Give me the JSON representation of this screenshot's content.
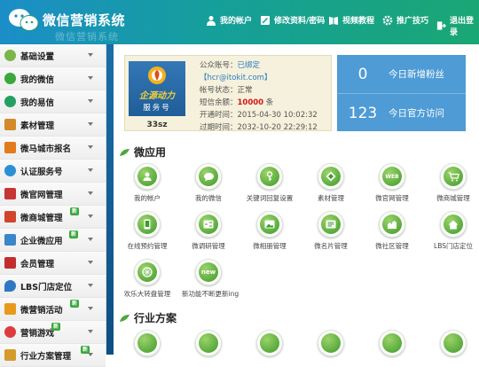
{
  "app": {
    "title": "微信营销系统",
    "subtitle": "微信营销系统"
  },
  "nav": [
    {
      "label": "我的帐户",
      "icon": "user-icon"
    },
    {
      "label": "修改资料/密码",
      "icon": "edit-icon"
    },
    {
      "label": "视频教程",
      "icon": "book-icon"
    },
    {
      "label": "推广技巧",
      "icon": "gear-icon"
    },
    {
      "label": "退出登录",
      "icon": "logout-icon"
    }
  ],
  "sidebar": {
    "items": [
      {
        "label": "基础设置",
        "icon": "settings-icon",
        "color": "#7ab648"
      },
      {
        "label": "我的微信",
        "icon": "wechat-icon",
        "color": "#3aa83a"
      },
      {
        "label": "我的易信",
        "icon": "yixin-icon",
        "color": "#24a060"
      },
      {
        "label": "素材管理",
        "icon": "material-icon",
        "color": "#d28a2a"
      },
      {
        "label": "微马城市报名",
        "icon": "city-icon",
        "color": "#e07c1c"
      },
      {
        "label": "认证服务号",
        "icon": "verify-icon",
        "color": "#2b8fd6"
      },
      {
        "label": "微官网管理",
        "icon": "site-icon",
        "color": "#c73434"
      },
      {
        "label": "微商城管理",
        "icon": "shop-icon",
        "color": "#d0452c",
        "badge": "新"
      },
      {
        "label": "企业微应用",
        "icon": "enterprise-icon",
        "color": "#3a86c8",
        "badge": "新"
      },
      {
        "label": "会员管理",
        "icon": "member-icon",
        "color": "#c22e2e"
      },
      {
        "label": "LBS门店定位",
        "icon": "location-icon",
        "color": "#2f78c4"
      },
      {
        "label": "微营销活动",
        "icon": "activity-icon",
        "color": "#e89a1c",
        "badge": "新"
      },
      {
        "label": "营销游戏",
        "icon": "game-icon",
        "color": "#dd3c3c",
        "badge": "新"
      },
      {
        "label": "行业方案管理",
        "icon": "industry-icon",
        "color": "#d59a2b",
        "badge": "新"
      }
    ]
  },
  "account": {
    "logo_tagline": "企源动力",
    "logo_service": "服务号",
    "name": "33sz",
    "public_label": "公众账号：",
    "public_status": "已绑定",
    "public_email": "【hcr@itokit.com】",
    "status_label": "帐号状态：",
    "status_value": "正常",
    "sms_label": "短信余额：",
    "sms_value": "10000",
    "sms_unit": "条",
    "open_label": "开通时间：",
    "open_value": "2015-04-30 10:02:32",
    "expire_label": "过期时间：",
    "expire_value": "2032-10-20 22:29:12"
  },
  "stats": [
    {
      "value": "0",
      "label": "今日新增粉丝"
    },
    {
      "value": "123",
      "label": "今日官方访问"
    }
  ],
  "sections": {
    "apps_title": "微应用",
    "industry_title": "行业方案"
  },
  "apps": [
    {
      "label": "我的帐户",
      "icon": "user-icon"
    },
    {
      "label": "我的微信",
      "icon": "chat-icon"
    },
    {
      "label": "关键词回复设置",
      "icon": "key-icon"
    },
    {
      "label": "素材管理",
      "icon": "material-icon"
    },
    {
      "label": "微官网管理",
      "icon": "web-icon",
      "text": "WEB"
    },
    {
      "label": "微商城管理",
      "icon": "cart-icon"
    },
    {
      "label": "在线预约管理",
      "icon": "phone-icon"
    },
    {
      "label": "微调研管理",
      "icon": "survey-icon"
    },
    {
      "label": "微相册管理",
      "icon": "album-icon"
    },
    {
      "label": "微名片管理",
      "icon": "card-icon"
    },
    {
      "label": "微社区管理",
      "icon": "community-icon"
    },
    {
      "label": "LBS门店定位",
      "icon": "home-icon"
    },
    {
      "label": "欢乐大转盘管理",
      "icon": "wheel-icon"
    },
    {
      "label": "新功能不断更新ing",
      "icon": "new-icon",
      "text": "new"
    }
  ],
  "industry_apps": [
    {
      "icon": "food-icon"
    },
    {
      "icon": "hotel-icon"
    },
    {
      "icon": "education-icon"
    },
    {
      "icon": "house-icon"
    },
    {
      "icon": "wedding-icon"
    },
    {
      "icon": "car-icon"
    },
    {
      "icon": "medical-icon"
    }
  ]
}
